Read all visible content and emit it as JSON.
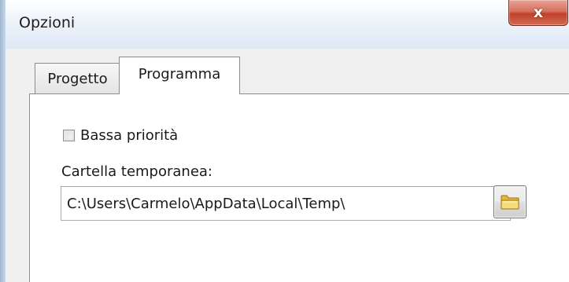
{
  "window": {
    "title": "Opzioni",
    "close_glyph": "x"
  },
  "tabs": [
    {
      "label": "Progetto",
      "selected": false
    },
    {
      "label": "Programma",
      "selected": true
    }
  ],
  "program_tab": {
    "low_priority": {
      "label": "Bassa priorità",
      "checked": false
    },
    "temp_folder": {
      "label": "Cartella temporanea:",
      "value": "C:\\Users\\Carmelo\\AppData\\Local\\Temp\\"
    },
    "browse_button": {
      "icon": "folder-icon"
    }
  },
  "colors": {
    "close_button": "#c7503a",
    "folder_icon": "#f2c94c"
  }
}
